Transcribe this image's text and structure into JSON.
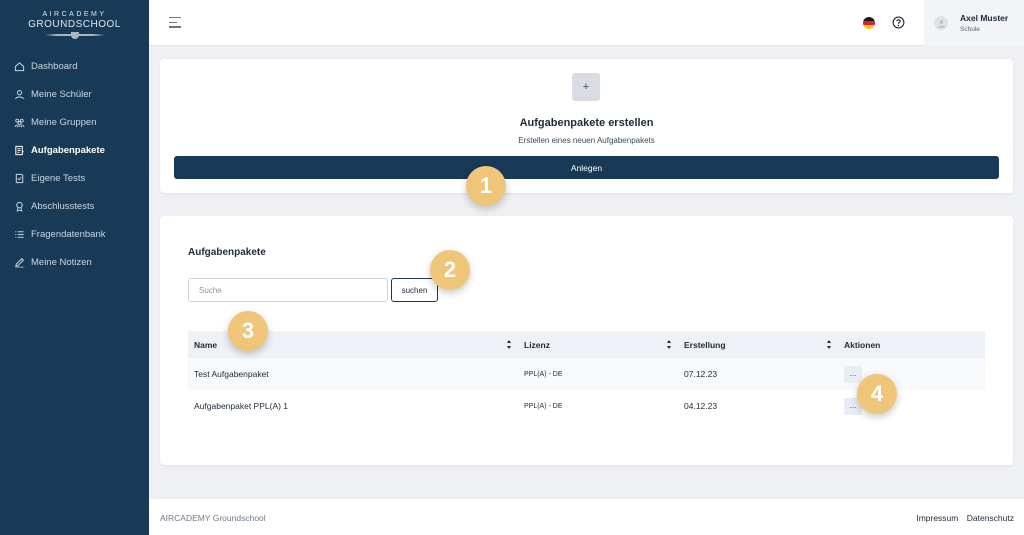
{
  "brand": {
    "logo_top": "AIRCADEMY",
    "logo_main": "GROUNDSCHOOL"
  },
  "sidebar": {
    "items": [
      {
        "label": "Dashboard",
        "icon": "home-icon",
        "active": false
      },
      {
        "label": "Meine Schüler",
        "icon": "user-icon",
        "active": false
      },
      {
        "label": "Meine Gruppen",
        "icon": "group-icon",
        "active": false
      },
      {
        "label": "Aufgabenpakete",
        "icon": "document-icon",
        "active": true
      },
      {
        "label": "Eigene Tests",
        "icon": "test-icon",
        "active": false
      },
      {
        "label": "Abschlusstests",
        "icon": "award-icon",
        "active": false
      },
      {
        "label": "Fragendatenbank",
        "icon": "list-icon",
        "active": false
      },
      {
        "label": "Meine Notizen",
        "icon": "pencil-icon",
        "active": false
      }
    ]
  },
  "topbar": {
    "menu_icon": "menu-icon",
    "language_icon": "german-flag-icon",
    "help_icon": "help-icon",
    "user": {
      "name": "Axel Muster",
      "role": "Schule",
      "avatar_icon": "user-avatar-icon"
    }
  },
  "create_card": {
    "plus_label": "+",
    "title": "Aufgabenpakete erstellen",
    "subtitle": "Erstellen eines neuen Aufgabenpakets",
    "button_label": "Anlegen"
  },
  "list_card": {
    "title": "Aufgabenpakete",
    "search": {
      "placeholder": "Suche",
      "value": "",
      "button_label": "suchen"
    },
    "table": {
      "columns": [
        "Name",
        "Lizenz",
        "Erstellung",
        "Aktionen"
      ],
      "rows": [
        {
          "name": "Test Aufgabenpaket",
          "lizenz": "PPL(A) - DE",
          "erstellung": "07.12.23",
          "action_label": "..."
        },
        {
          "name": "Aufgabenpaket PPL(A) 1",
          "lizenz": "PPL(A) - DE",
          "erstellung": "04.12.23",
          "action_label": "..."
        }
      ]
    }
  },
  "footer": {
    "brand": "AIRCADEMY Groundschool",
    "links": [
      "Impressum",
      "Datenschutz"
    ]
  },
  "annotations": [
    "1",
    "2",
    "3",
    "4"
  ],
  "colors": {
    "sidebar_bg": "#183a57",
    "primary": "#183a57",
    "badge": "#efc57a",
    "page_bg": "#eef0f3"
  }
}
